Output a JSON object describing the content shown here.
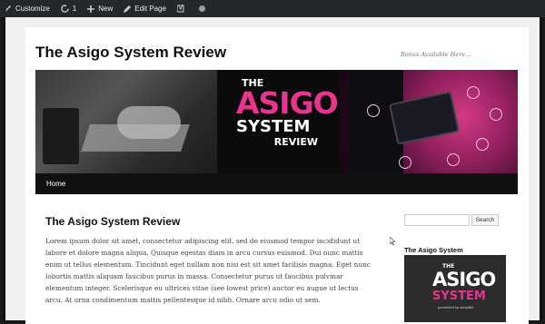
{
  "adminbar": {
    "customize": "Customize",
    "updates_count": "1",
    "new": "New",
    "edit_page": "Edit Page"
  },
  "site": {
    "title": "The Asigo System Review",
    "tagline": "Bonus Available Here..."
  },
  "banner": {
    "the": "THE",
    "asigo": "ASIGO",
    "system": "SYSTEM",
    "review": "REVIEW",
    "tm": "™"
  },
  "nav": {
    "items": [
      {
        "label": "Home"
      }
    ]
  },
  "post": {
    "title": "The Asigo System Review",
    "body": "Lorem ipsum dolor sit amet, consectetur adipiscing elit, sed do eiusmod tempor incididunt ut labore et dolore magna aliqua. Quisque egestas diam in arcu cursus euismod. Dui nunc mattis enim ut tellus elementum. Tincidunt eget nullam non nisi est sit amet facilisis magna. Eget nunc lobortis mattis aliquam faucibus purus in massa. Consectetur purus ut faucibus pulvinar elementum integer. Scelerisque eu ultrices vitae (see lowest price) auctor eu augue ut lectus arcu. At urna condimentum mattis pellentesque id nibh. Ornare arcu odio ut sem."
  },
  "sidebar": {
    "search_placeholder": "",
    "search_button": "Search",
    "widget_title": "The Asigo System",
    "widget_logo": {
      "the": "THE",
      "asigo": "ASIGO",
      "system": "SYSTEM",
      "byline": "presented by simplilife"
    }
  },
  "colors": {
    "accent_pink": "#e8348c",
    "admin_bar": "#23282d",
    "nav_bg": "#111111"
  }
}
